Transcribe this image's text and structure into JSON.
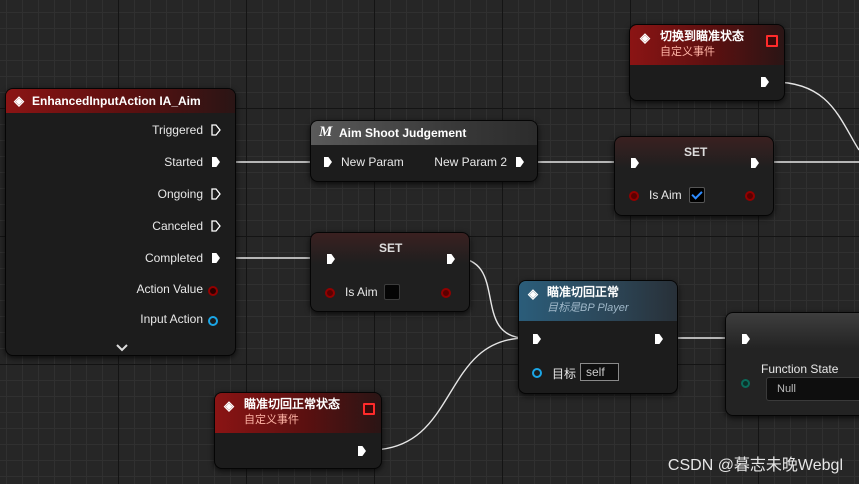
{
  "nodes": {
    "enhanced": {
      "title": "EnhancedInputAction IA_Aim",
      "pins": {
        "triggered": "Triggered",
        "started": "Started",
        "ongoing": "Ongoing",
        "canceled": "Canceled",
        "completed": "Completed",
        "action_value": "Action Value",
        "input_action": "Input Action"
      },
      "expand_icon": "chevron-down-icon"
    },
    "aim_shoot": {
      "title": "Aim Shoot Judgement",
      "macro_glyph": "M",
      "in_pin": "New Param",
      "out_pin": "New Param 2"
    },
    "set_true": {
      "title": "SET",
      "var_label": "Is Aim",
      "checked": true
    },
    "set_false": {
      "title": "SET",
      "var_label": "Is Aim",
      "checked": false
    },
    "switch_event": {
      "title": "切换到瞄准状态",
      "subtitle": "自定义事件"
    },
    "restore_fn": {
      "title": "瞄准切回正常",
      "subtitle_prefix": "目标是",
      "subtitle_target": "BP Player",
      "target_label": "目标",
      "target_value": "self"
    },
    "restore_event": {
      "title": "瞄准切回正常状态",
      "subtitle": "自定义事件"
    },
    "function_state": {
      "label": "Function State",
      "value": "Null"
    }
  },
  "watermark": "CSDN @暮志未晚Webgl",
  "colors": {
    "event_header": "#8b1414",
    "macro_header": "#5a5a5a",
    "function_header": "#2b5d7a",
    "bool_pin": "#930000",
    "object_pin": "#1ba6e6",
    "struct_pin": "#0a6b5a",
    "checkbox_check": "#2e8cff"
  }
}
